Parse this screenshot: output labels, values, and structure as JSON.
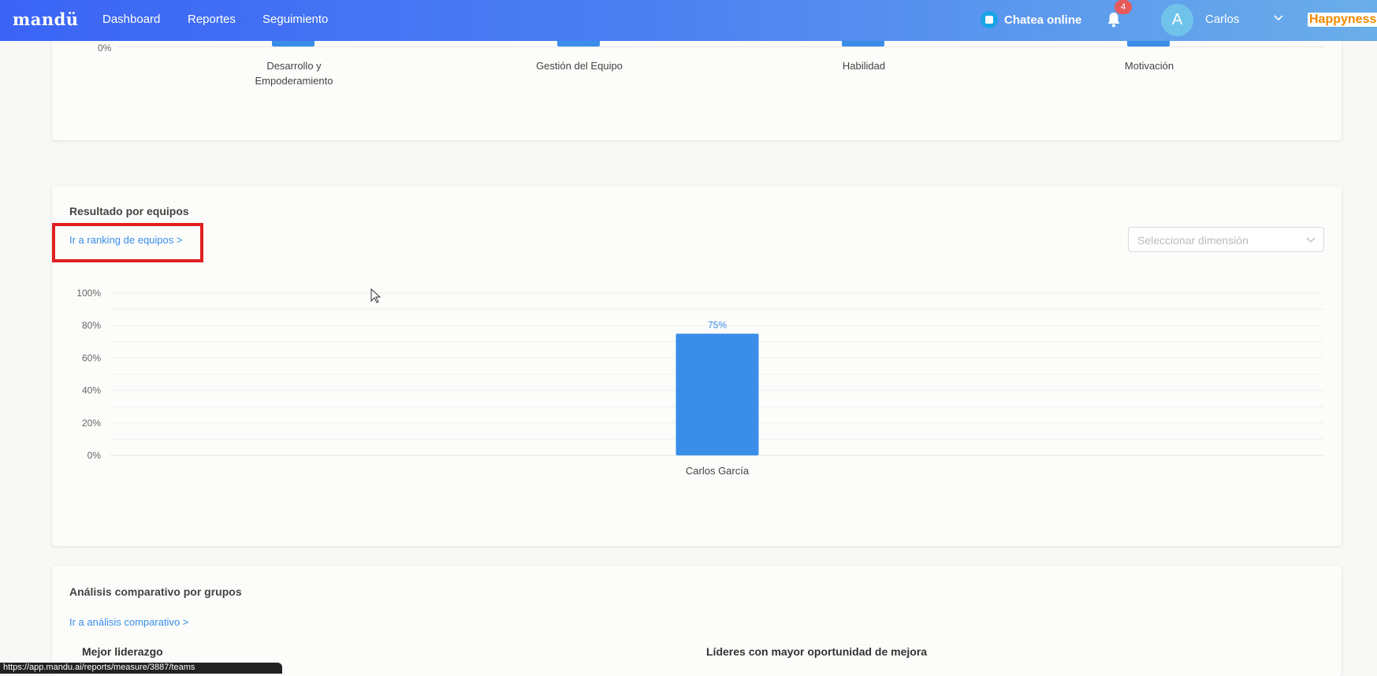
{
  "nav": {
    "logo": "mandü",
    "links": [
      "Dashboard",
      "Reportes",
      "Seguimiento"
    ],
    "chat_label": "Chatea online",
    "notification_count": "4",
    "avatar_letter": "A",
    "user_name": "Carlos",
    "brand": "Happyness"
  },
  "top_chart": {
    "zero_label": "0%",
    "categories": [
      {
        "line1": "Desarrollo y",
        "line2": "Empoderamiento"
      },
      {
        "line1": "Gestión del Equipo",
        "line2": ""
      },
      {
        "line1": "Habilidad",
        "line2": ""
      },
      {
        "line1": "Motivación",
        "line2": ""
      }
    ]
  },
  "teams_section": {
    "title": "Resultado por equipos",
    "ranking_link": "Ir a ranking de equipos >",
    "dimension_placeholder": "Seleccionar dimensión"
  },
  "chart_data": {
    "type": "bar",
    "categories": [
      "Carlos García"
    ],
    "values": [
      75
    ],
    "data_labels": [
      "75%"
    ],
    "y_ticks": [
      "0%",
      "20%",
      "40%",
      "60%",
      "80%",
      "100%"
    ],
    "ylim": [
      0,
      100
    ],
    "color": "#3a8ee8",
    "grid": true
  },
  "comparative_section": {
    "title": "Análisis comparativo por grupos",
    "link": "Ir a análisis comparativo >",
    "best_leadership": "Mejor liderazgo",
    "improvement_leaders": "Líderes con mayor oportunidad de mejora"
  },
  "status_url": "https://app.mandu.ai/reports/measure/3887/teams"
}
